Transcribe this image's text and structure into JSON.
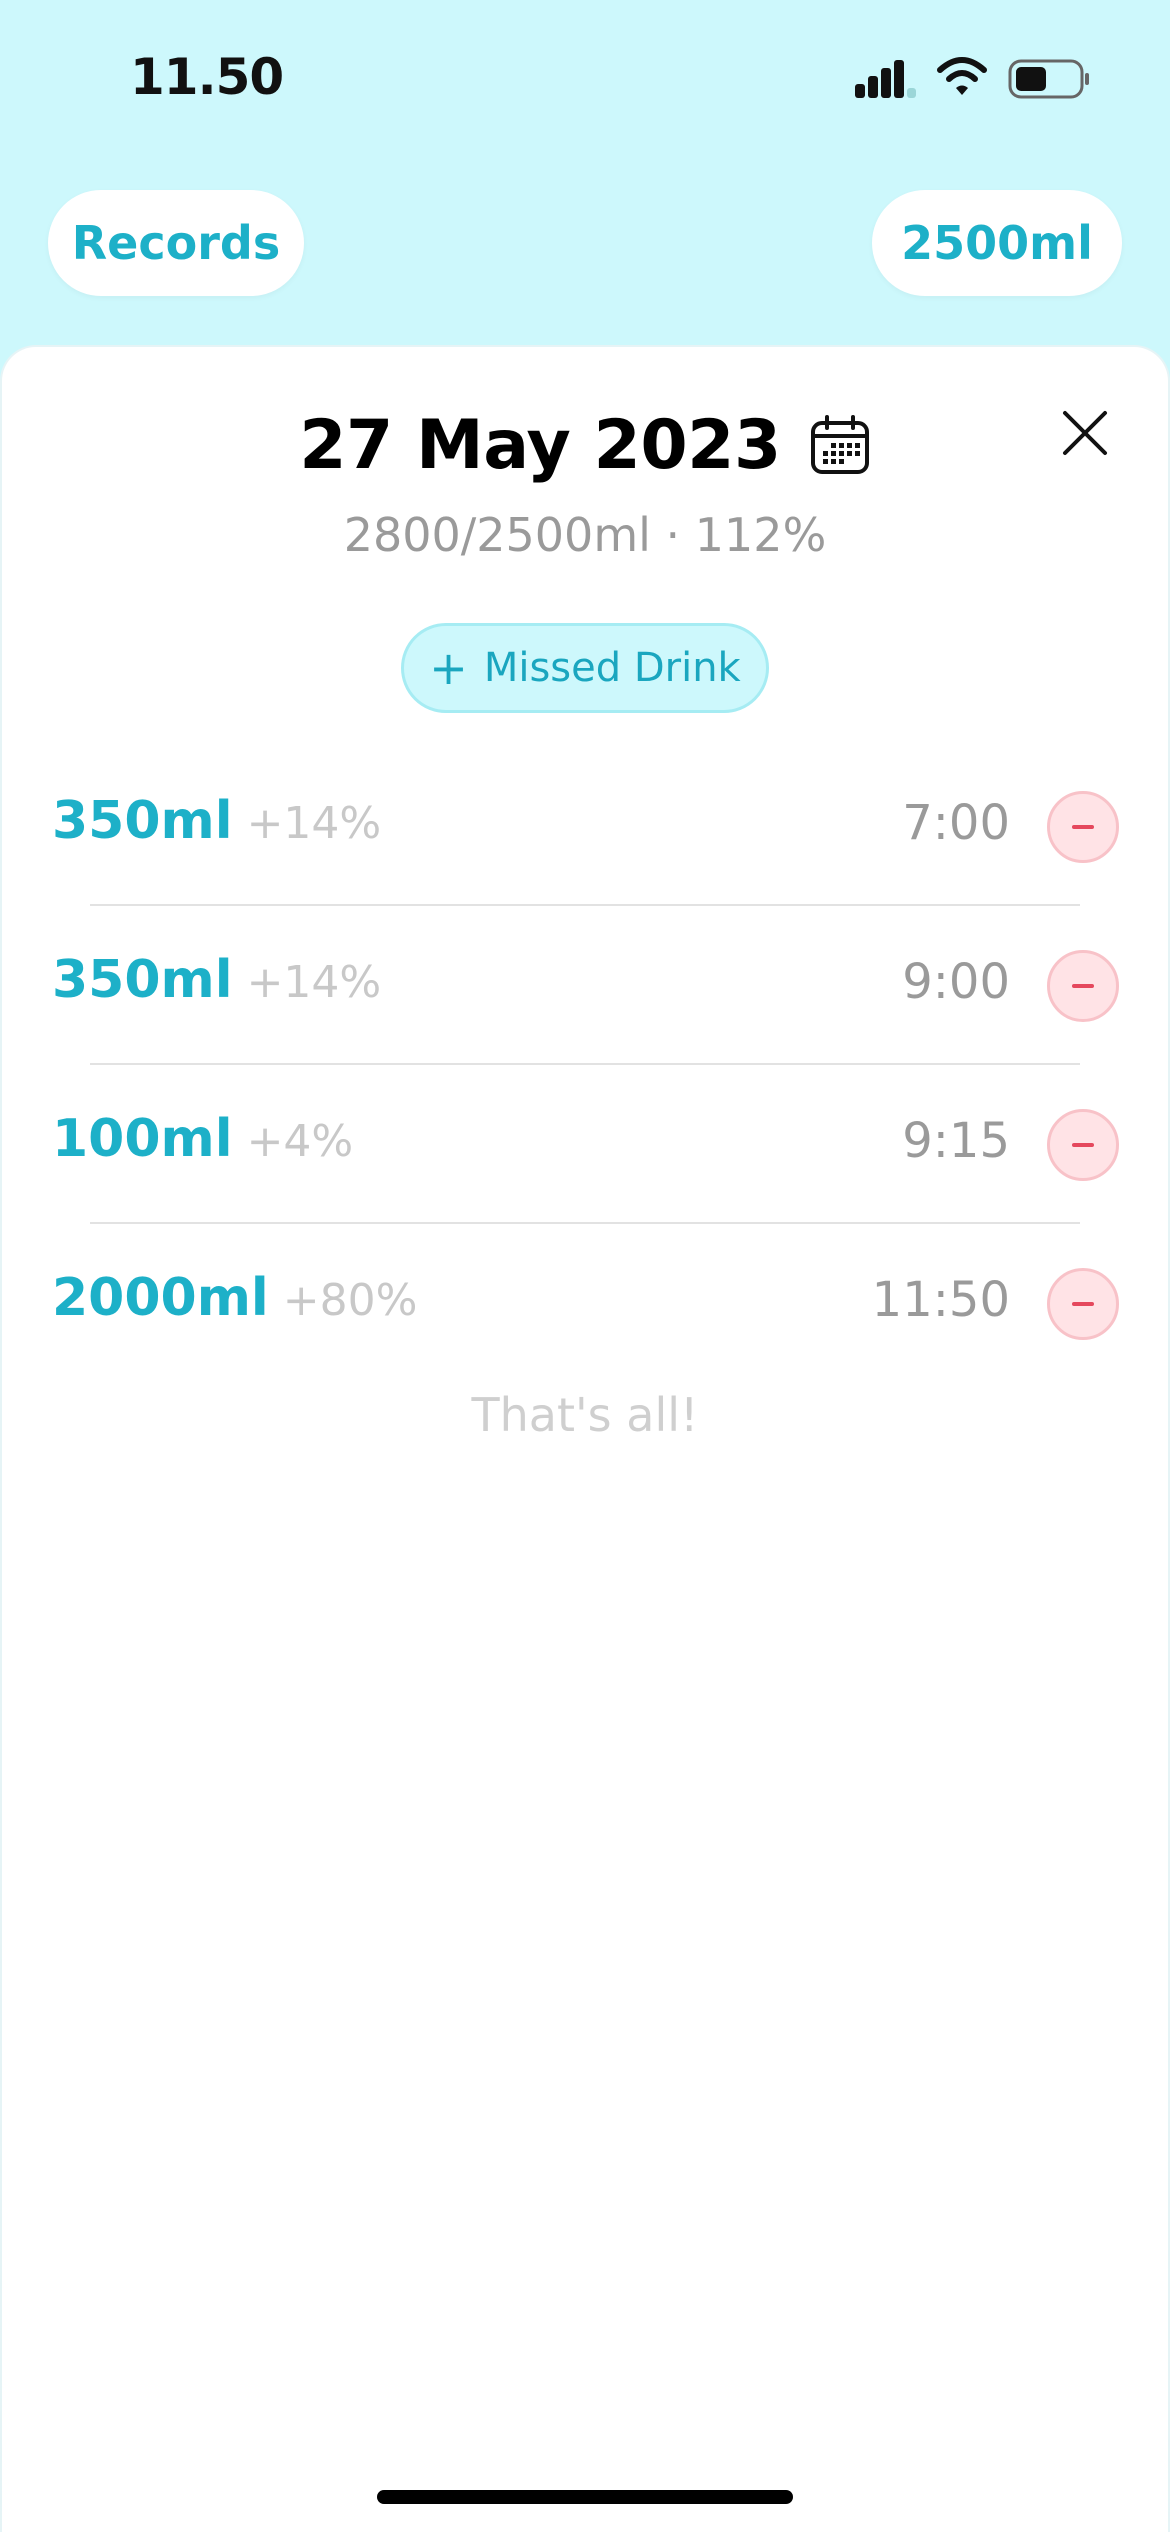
{
  "status": {
    "time": "11.50"
  },
  "header": {
    "records_label": "Records",
    "goal_label": "2500ml"
  },
  "sheet": {
    "title": "27 May 2023",
    "summary": "2800/2500ml · 112%",
    "missed_drink_label": "Missed Drink",
    "entries": [
      {
        "amount": "350ml",
        "percent": "+14%",
        "time": "7:00"
      },
      {
        "amount": "350ml",
        "percent": "+14%",
        "time": "9:00"
      },
      {
        "amount": "100ml",
        "percent": "+4%",
        "time": "9:15"
      },
      {
        "amount": "2000ml",
        "percent": "+80%",
        "time": "11:50"
      }
    ],
    "end_note": "That's all!"
  },
  "colors": {
    "background": "#cdf8fc",
    "accent": "#1db0c8",
    "remove_bg": "#ffe3e6",
    "remove_fg": "#e5485d"
  }
}
